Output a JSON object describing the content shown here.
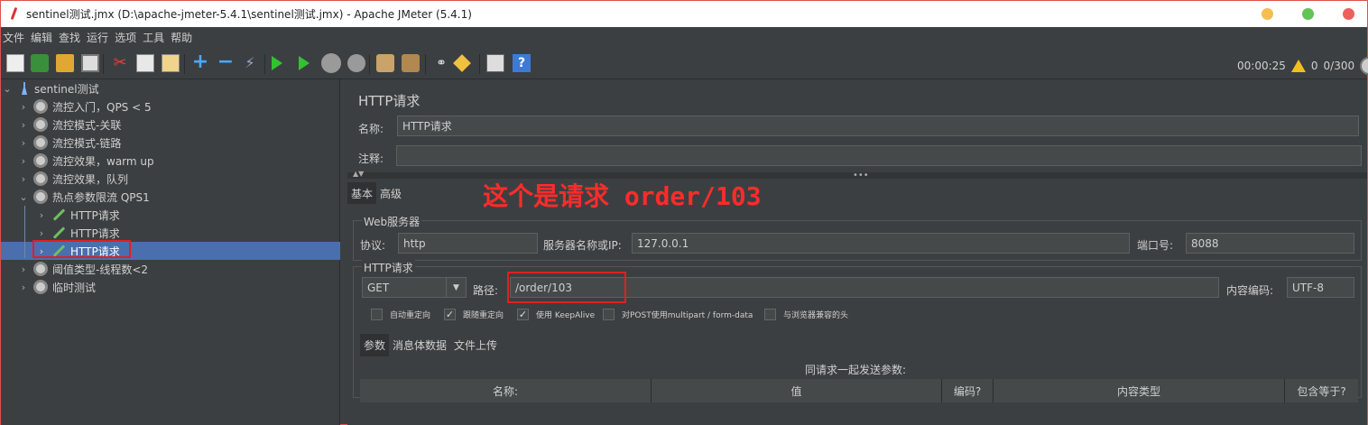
{
  "window": {
    "title": "sentinel测试.jmx (D:\\apache-jmeter-5.4.1\\sentinel测试.jmx) - Apache JMeter (5.4.1)"
  },
  "menu": [
    "文件",
    "编辑",
    "查找",
    "运行",
    "选项",
    "工具",
    "帮助"
  ],
  "toolbar_status": {
    "elapsed": "00:00:25",
    "warnings": "0",
    "threads": "0/300"
  },
  "tree": {
    "root": "sentinel测试",
    "items": [
      {
        "label": "流控入门，QPS < 5"
      },
      {
        "label": "流控模式-关联"
      },
      {
        "label": "流控模式-链路"
      },
      {
        "label": "流控效果，warm up"
      },
      {
        "label": "流控效果，队列"
      },
      {
        "label": "热点参数限流 QPS1"
      },
      {
        "label": "HTTP请求"
      },
      {
        "label": "HTTP请求"
      },
      {
        "label": "HTTP请求"
      },
      {
        "label": "阈值类型-线程数<2"
      },
      {
        "label": "临时测试"
      }
    ]
  },
  "panel": {
    "title": "HTTP请求",
    "name_label": "名称:",
    "name_value": "HTTP请求",
    "comment_label": "注释:",
    "comment_value": "",
    "tabs": [
      "基本",
      "高级"
    ],
    "annotation": "这个是请求 order/103",
    "web_server": {
      "title": "Web服务器",
      "protocol_label": "协议:",
      "protocol_value": "http",
      "server_label": "服务器名称或IP:",
      "server_value": "127.0.0.1",
      "port_label": "端口号:",
      "port_value": "8088"
    },
    "http_request": {
      "title": "HTTP请求",
      "method": "GET",
      "path_label": "路径:",
      "path_value": "/order/103",
      "encoding_label": "内容编码:",
      "encoding_value": "UTF-8"
    },
    "checkboxes": [
      {
        "label": "自动重定向",
        "checked": false
      },
      {
        "label": "跟随重定向",
        "checked": true
      },
      {
        "label": "使用 KeepAlive",
        "checked": true
      },
      {
        "label": "对POST使用multipart / form-data",
        "checked": false
      },
      {
        "label": "与浏览器兼容的头",
        "checked": false
      }
    ],
    "subtabs": [
      "参数",
      "消息体数据",
      "文件上传"
    ],
    "params_caption": "同请求一起发送参数:",
    "columns": [
      "名称:",
      "值",
      "编码?",
      "内容类型",
      "包含等于?"
    ]
  }
}
